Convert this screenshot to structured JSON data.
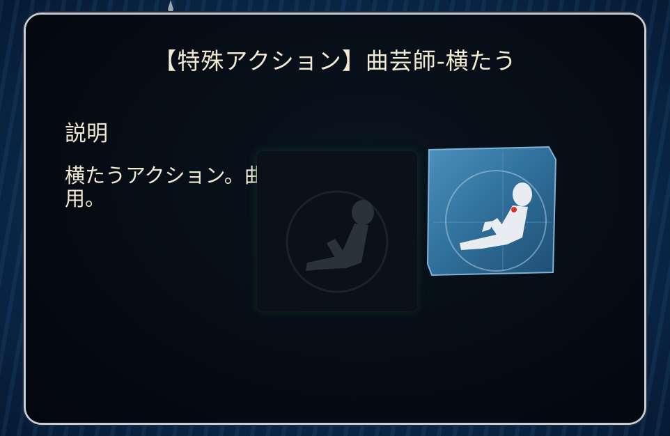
{
  "dialog": {
    "title": "【特殊アクション】曲芸師-横たう",
    "section_heading": "説明",
    "description": "横たうアクション。曲芸師専用。"
  },
  "icons": {
    "ornament": "diamond-ornament-icon",
    "action": "reclining-figure-icon",
    "action_shadow": "reclining-figure-shadow-icon"
  },
  "colors": {
    "panel_bg": "#04080f",
    "panel_border": "#c9ced6",
    "text": "#f3ead2",
    "icon_tile": "#2f6f9a",
    "backdrop": "#0a2a4c"
  }
}
